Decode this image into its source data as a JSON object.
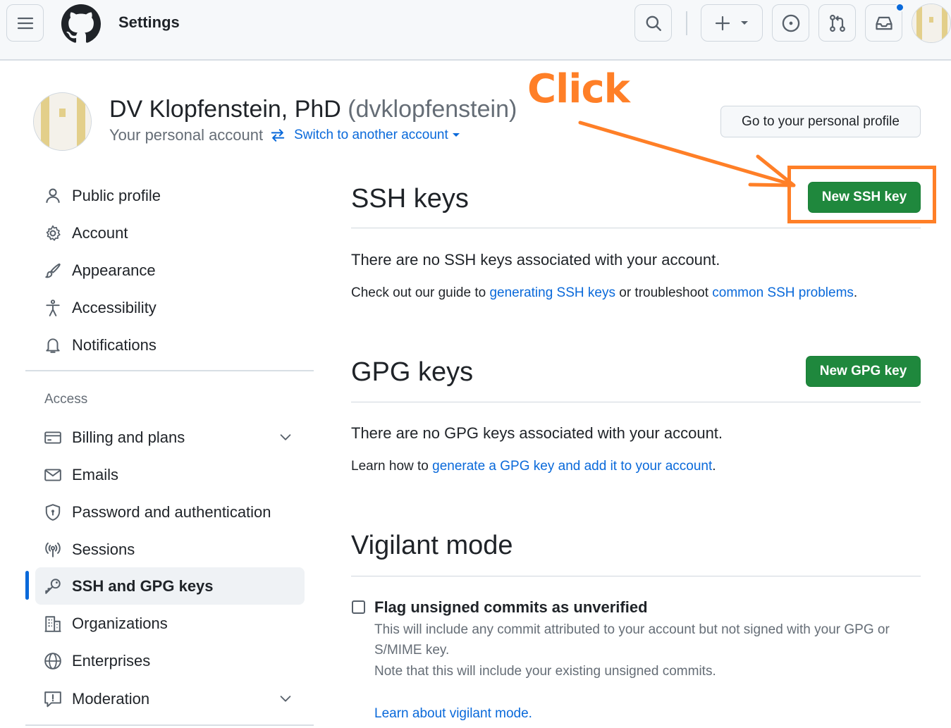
{
  "header": {
    "title": "Settings",
    "icons": [
      "menu-icon",
      "github-logo-icon",
      "search-icon",
      "plus-icon",
      "triangle-down-icon",
      "issue-icon",
      "pull-request-icon",
      "inbox-icon"
    ]
  },
  "profile": {
    "name": "DV Klopfenstein, PhD",
    "handle": "(dvklopfenstein)",
    "subtitle": "Your personal account",
    "switch_link": "Switch to another account",
    "profile_button": "Go to your personal profile"
  },
  "annotation": {
    "label": "Click",
    "color": "#ff7f27"
  },
  "sidebar": {
    "items": [
      {
        "label": "Public profile",
        "icon": "person-icon"
      },
      {
        "label": "Account",
        "icon": "gear-icon"
      },
      {
        "label": "Appearance",
        "icon": "paintbrush-icon"
      },
      {
        "label": "Accessibility",
        "icon": "accessibility-icon"
      },
      {
        "label": "Notifications",
        "icon": "bell-icon"
      }
    ],
    "access_heading": "Access",
    "access_items": [
      {
        "label": "Billing and plans",
        "icon": "credit-card-icon",
        "expandable": true
      },
      {
        "label": "Emails",
        "icon": "mail-icon"
      },
      {
        "label": "Password and authentication",
        "icon": "shield-lock-icon"
      },
      {
        "label": "Sessions",
        "icon": "broadcast-icon"
      },
      {
        "label": "SSH and GPG keys",
        "icon": "key-icon",
        "active": true
      },
      {
        "label": "Organizations",
        "icon": "organization-icon"
      },
      {
        "label": "Enterprises",
        "icon": "globe-icon"
      },
      {
        "label": "Moderation",
        "icon": "report-icon",
        "expandable": true
      }
    ]
  },
  "ssh": {
    "title": "SSH keys",
    "button": "New SSH key",
    "empty_text": "There are no SSH keys associated with your account.",
    "guide_prefix": "Check out our guide to ",
    "guide_link1": "generating SSH keys",
    "guide_middle": " or troubleshoot ",
    "guide_link2": "common SSH problems",
    "guide_suffix": "."
  },
  "gpg": {
    "title": "GPG keys",
    "button": "New GPG key",
    "empty_text": "There are no GPG keys associated with your account.",
    "learn_prefix": "Learn how to ",
    "learn_link": "generate a GPG key and add it to your account",
    "learn_suffix": "."
  },
  "vigilant": {
    "title": "Vigilant mode",
    "checkbox_label": "Flag unsigned commits as unverified",
    "checked": false,
    "desc_line1": "This will include any commit attributed to your account but not signed with your GPG or",
    "desc_line2": "S/MIME key.",
    "desc_line3": "Note that this will include your existing unsigned commits.",
    "learn_link": "Learn about vigilant mode."
  },
  "colors": {
    "green_button": "#1f883d",
    "link": "#0969da",
    "active_indicator": "#0969da"
  }
}
